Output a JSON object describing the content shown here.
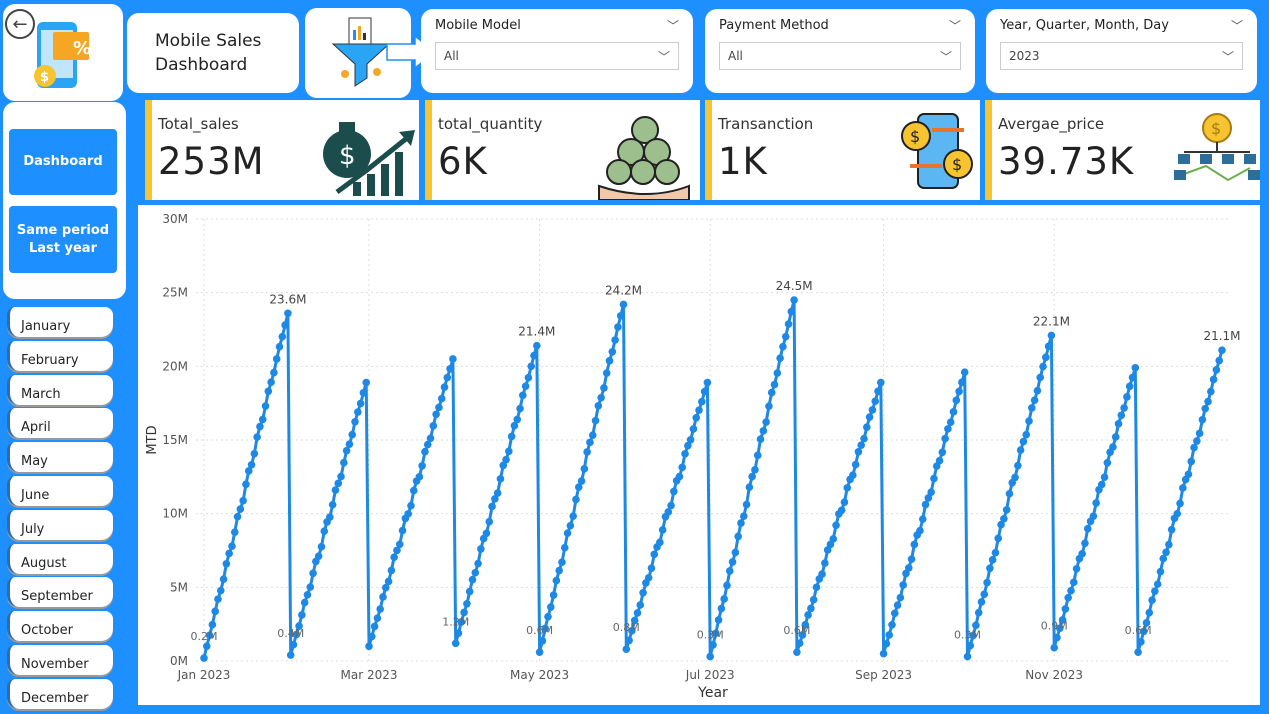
{
  "header": {
    "title": "Mobile Sales\nDashboard",
    "back_icon": "back-arrow-icon"
  },
  "slicers": [
    {
      "label": "Mobile Model",
      "value": "All"
    },
    {
      "label": "Payment Method",
      "value": "All"
    },
    {
      "label": "Year, Quarter, Month, Day",
      "value": "2023"
    }
  ],
  "nav": {
    "dashboard": "Dashboard",
    "same_period": "Same period\nLast year"
  },
  "months": [
    "January",
    "February",
    "March",
    "April",
    "May",
    "June",
    "July",
    "August",
    "September",
    "October",
    "November",
    "December"
  ],
  "kpis": [
    {
      "label": "Total_sales",
      "value": "253M",
      "icon": "money-bag-growth-icon"
    },
    {
      "label": "total_quantity",
      "value": "6K",
      "icon": "coin-stack-hand-icon"
    },
    {
      "label": "Transanction",
      "value": "1K",
      "icon": "phone-transfer-icon"
    },
    {
      "label": "Avergae_price",
      "value": "39.73K",
      "icon": "coin-network-icon"
    }
  ],
  "colors": {
    "accent": "#1e8fff",
    "kpi_bar": "#f4c531",
    "line": "#1e88e5"
  },
  "chart_data": {
    "type": "line",
    "xlabel": "Year",
    "ylabel": "MTD",
    "ylim": [
      0,
      30
    ],
    "y_ticks": [
      "0M",
      "5M",
      "10M",
      "15M",
      "20M",
      "25M",
      "30M"
    ],
    "x_ticks": [
      "Jan 2023",
      "Mar 2023",
      "May 2023",
      "Jul 2023",
      "Sep 2023",
      "Nov 2023"
    ],
    "grid": true,
    "series": [
      {
        "values_by_month": [
          {
            "month": "Jan",
            "start": 0.2,
            "end": 23.6,
            "start_label": "0.2M",
            "end_label": "23.6M"
          },
          {
            "month": "Feb",
            "start": 0.4,
            "end": 18.9,
            "start_label": "0.4M",
            "end_label": ""
          },
          {
            "month": "Mar",
            "start": 1.0,
            "end": 20.5,
            "start_label": "",
            "end_label": ""
          },
          {
            "month": "Apr",
            "start": 1.2,
            "end": 21.4,
            "start_label": "1.2M",
            "end_label": "21.4M"
          },
          {
            "month": "May",
            "start": 0.6,
            "end": 24.2,
            "start_label": "0.6M",
            "end_label": "24.2M"
          },
          {
            "month": "Jun",
            "start": 0.8,
            "end": 18.9,
            "start_label": "0.8M",
            "end_label": ""
          },
          {
            "month": "Jul",
            "start": 0.3,
            "end": 24.5,
            "start_label": "0.3M",
            "end_label": "24.5M"
          },
          {
            "month": "Aug",
            "start": 0.6,
            "end": 18.9,
            "start_label": "0.6M",
            "end_label": ""
          },
          {
            "month": "Sep",
            "start": 0.5,
            "end": 19.6,
            "start_label": "",
            "end_label": ""
          },
          {
            "month": "Oct",
            "start": 0.3,
            "end": 22.1,
            "start_label": "0.3M",
            "end_label": "22.1M"
          },
          {
            "month": "Nov",
            "start": 0.9,
            "end": 19.9,
            "start_label": "0.9M",
            "end_label": ""
          },
          {
            "month": "Dec",
            "start": 0.6,
            "end": 21.1,
            "start_label": "0.6M",
            "end_label": "21.1M"
          }
        ]
      }
    ]
  }
}
